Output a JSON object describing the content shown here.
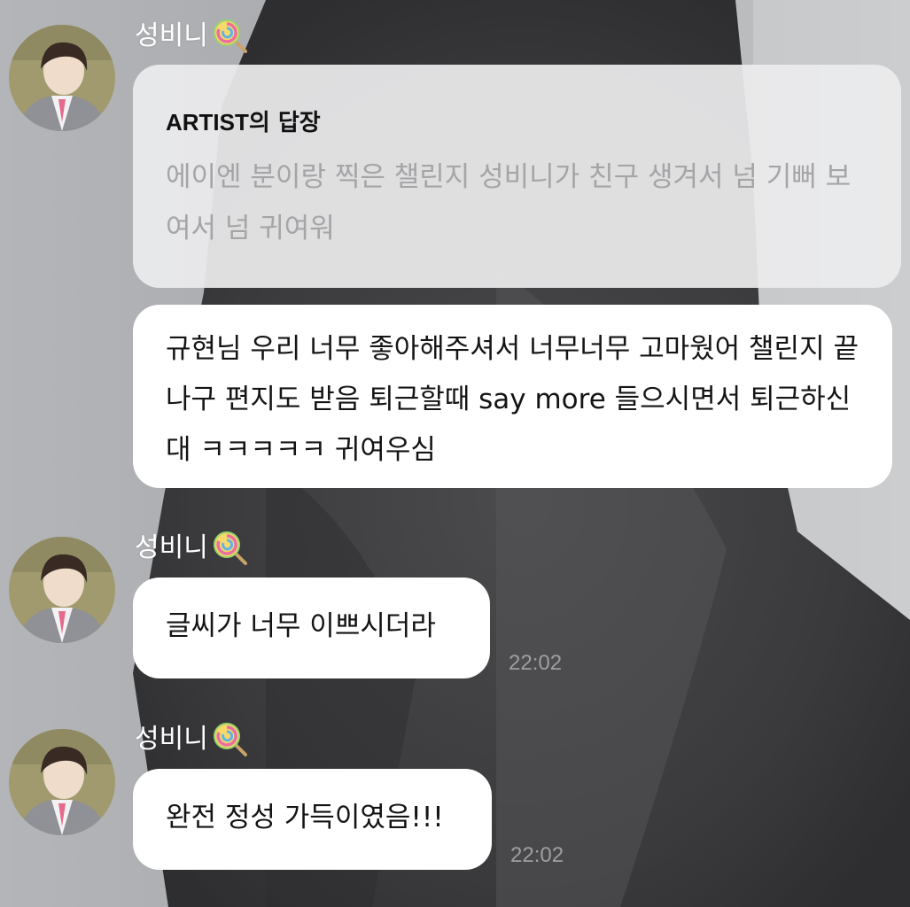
{
  "chat": {
    "artist_reply": {
      "sender": "성비니",
      "reply_label_prefix": "ARTIST",
      "reply_label_suffix": "의 답장",
      "quoted_text": "에이엔 분이랑 찍은 챌린지 성비니가 친구 생겨서 넘 기뻐 보여서 넘 귀여워",
      "reply_text": "규현님 우리 너무 좋아해주셔서 너무너무 고마웠어 챌린지 끝나구 편지도 받음 퇴근할때 say more 들으시면서 퇴근하신대 ㅋㅋㅋㅋㅋ 귀여우심"
    },
    "messages": [
      {
        "sender": "성비니",
        "text": "글씨가 너무 이쁘시더라",
        "time": "22:02"
      },
      {
        "sender": "성비니",
        "text": "완전 정성 가득이였음!!!",
        "time": "22:02"
      }
    ]
  },
  "icons": {
    "sender_badge": "lollipop-icon",
    "avatar": "profile-photo"
  },
  "colors": {
    "bubble": "#ffffff",
    "reply_bubble": "#ececed",
    "quoted_text": "#a5a5a8",
    "time": "#9e9e9e"
  }
}
